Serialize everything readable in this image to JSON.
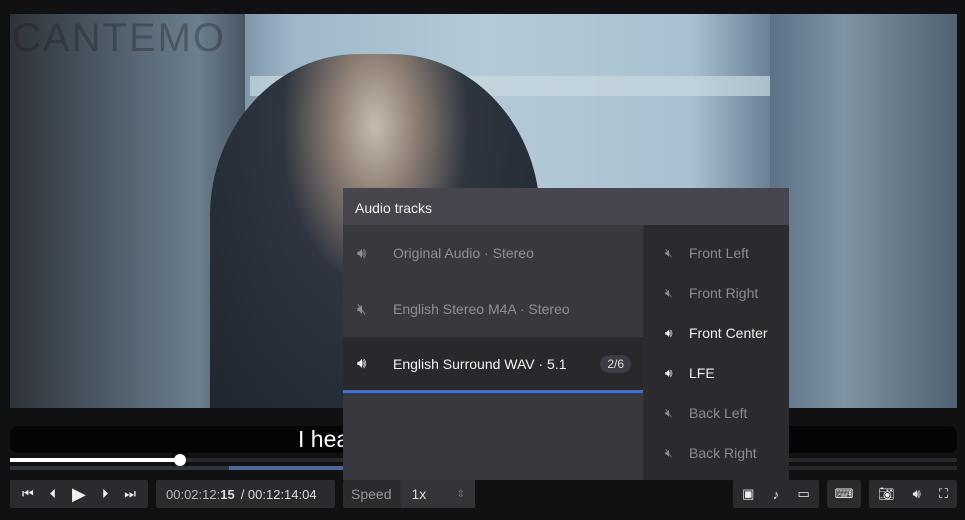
{
  "watermark": "CANTEMO",
  "subtitle": "I hea",
  "playback": {
    "progress_percent": 18,
    "current_time_prefix": "00:02:12:",
    "current_frames": "15",
    "duration": "/ 00:12:14:04"
  },
  "speed": {
    "label": "Speed",
    "value": "1x"
  },
  "audio_panel": {
    "title": "Audio tracks",
    "tracks": [
      {
        "label": "Original Audio · Stereo",
        "icon": "speaker-icon",
        "selected": false
      },
      {
        "label": "English Stereo M4A · Stereo",
        "icon": "speaker-muted-icon",
        "selected": false
      },
      {
        "label": "English Surround WAV · 5.1",
        "icon": "speaker-icon",
        "selected": true,
        "badge": "2/6"
      }
    ],
    "channels": [
      {
        "label": "Front Left",
        "enabled": false
      },
      {
        "label": "Front Right",
        "enabled": false
      },
      {
        "label": "Front Center",
        "enabled": true
      },
      {
        "label": "LFE",
        "enabled": true
      },
      {
        "label": "Back Left",
        "enabled": false
      },
      {
        "label": "Back Right",
        "enabled": false
      }
    ]
  },
  "colors": {
    "accent": "#4a6fb8",
    "panel": "#38383f",
    "controls": "#2a2a2f"
  }
}
